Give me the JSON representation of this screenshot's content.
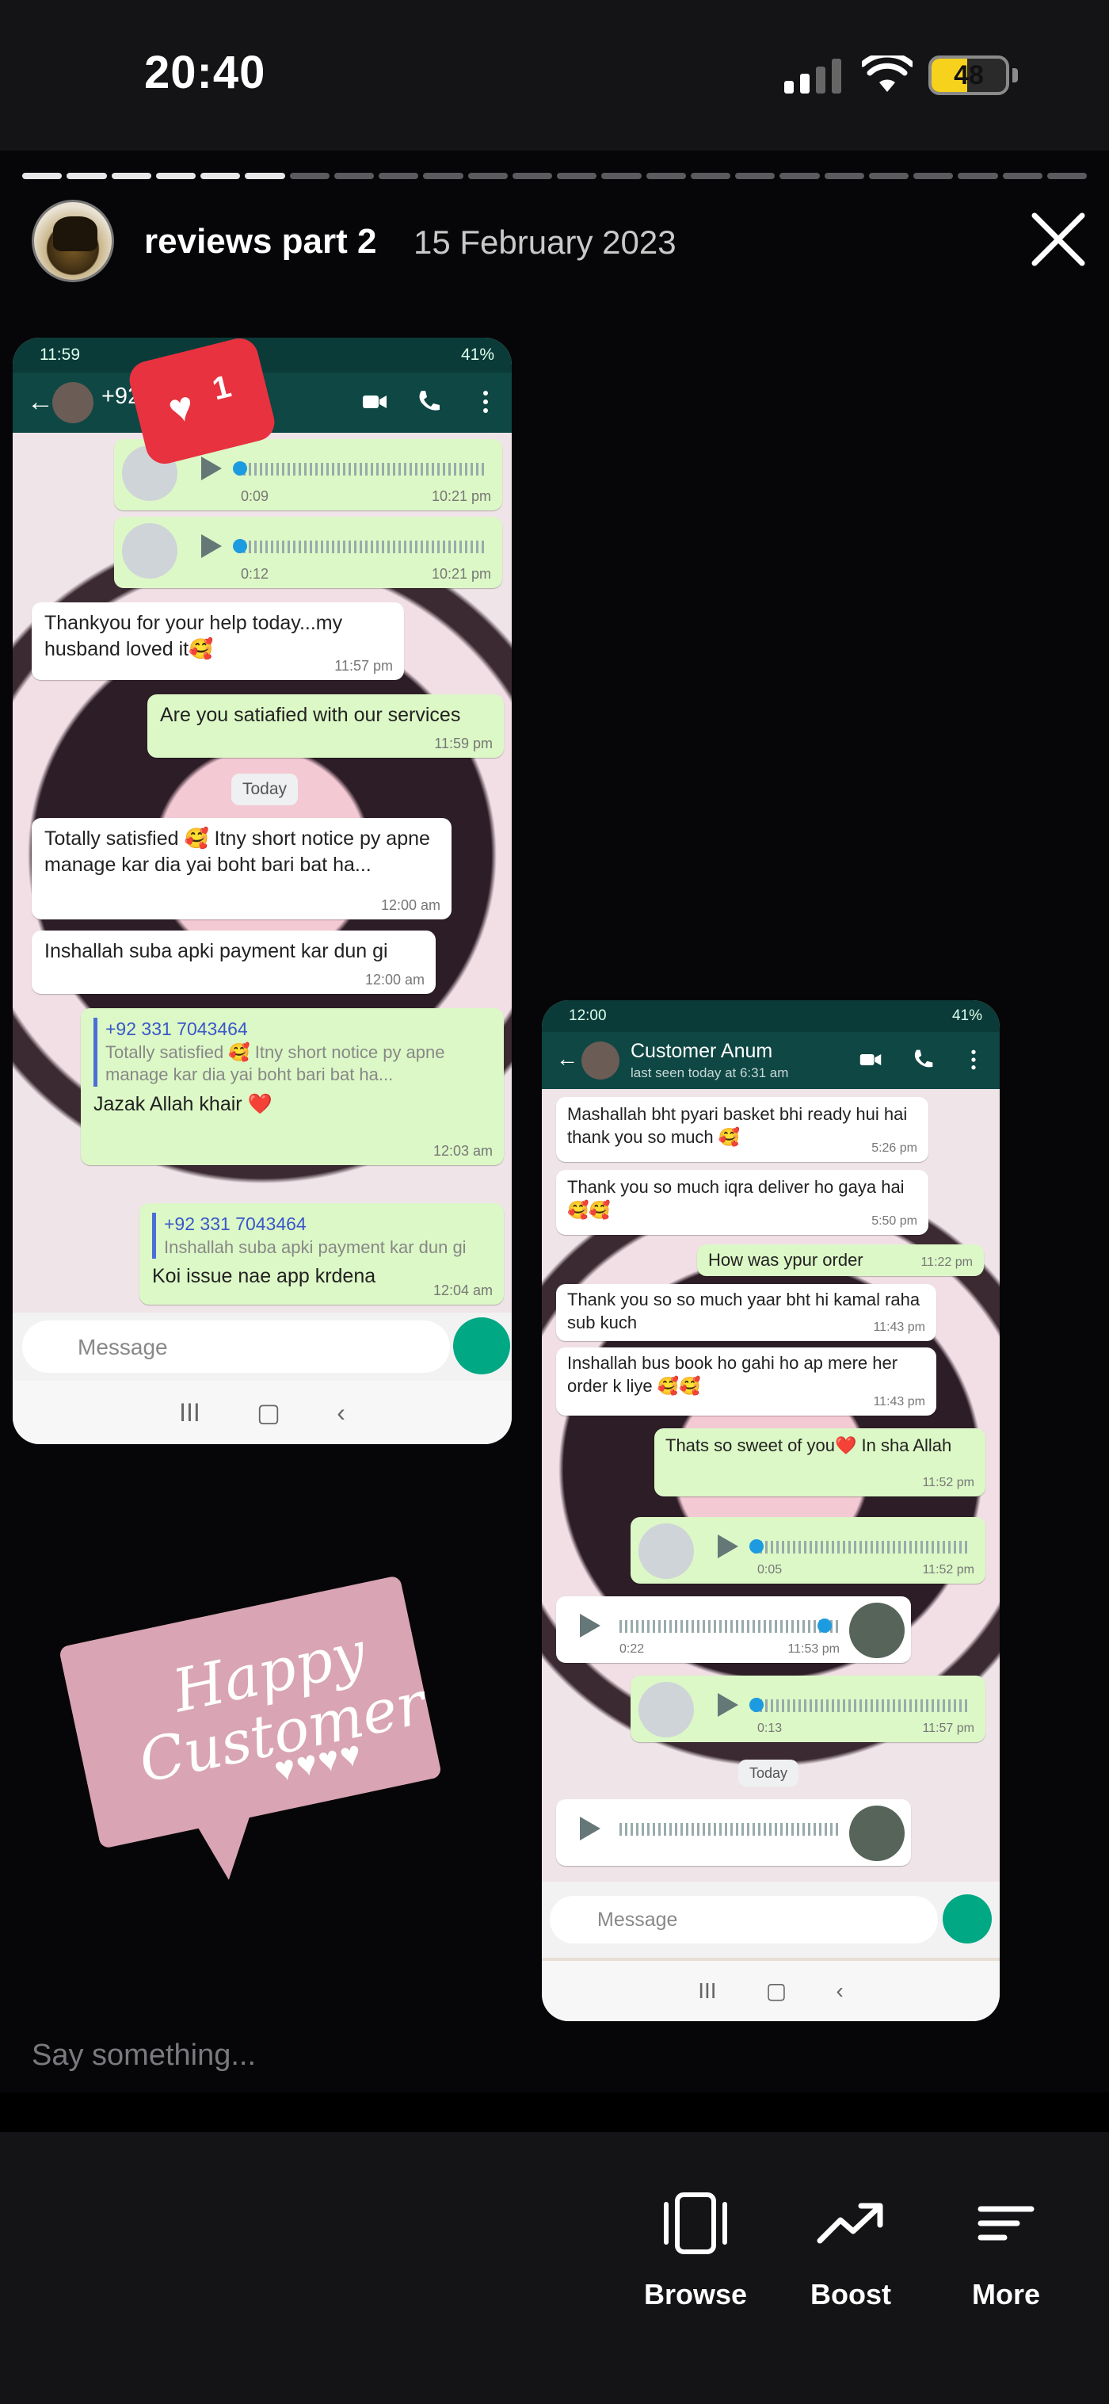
{
  "status_bar": {
    "time": "20:40",
    "battery": "48"
  },
  "story": {
    "title": "reviews part 2",
    "date": "15 February 2023",
    "progress_segments": 24,
    "progress_seen": 6,
    "reply_placeholder": "Say something..."
  },
  "screenshot_left": {
    "status_time": "11:59",
    "status_right": "41%",
    "contact": "+92",
    "reaction_count": "1",
    "messages": [
      {
        "kind": "voice",
        "dir": "out",
        "duration": "0:09",
        "time": "10:21 pm"
      },
      {
        "kind": "voice",
        "dir": "out",
        "duration": "0:12",
        "time": "10:21 pm"
      },
      {
        "kind": "text",
        "dir": "in",
        "text": "Thankyou for your help today...my husband loved it🥰",
        "time": "11:57 pm"
      },
      {
        "kind": "text",
        "dir": "out",
        "text": "Are you satiafied with our services",
        "time": "11:59 pm"
      },
      {
        "kind": "day",
        "text": "Today"
      },
      {
        "kind": "text",
        "dir": "in",
        "text": "Totally satisfied 🥰 Itny short notice py apne manage kar dia yai boht bari bat ha...",
        "time": "12:00 am"
      },
      {
        "kind": "text",
        "dir": "in",
        "text": "Inshallah suba apki payment kar dun gi",
        "time": "12:00 am"
      },
      {
        "kind": "reply",
        "dir": "out",
        "quote_from": "+92 331 7043464",
        "quote": "Totally satisfied 🥰 Itny short notice py apne manage kar dia yai boht bari bat ha...",
        "text": "Jazak Allah khair ❤️",
        "time": "12:03 am"
      },
      {
        "kind": "reply",
        "dir": "out",
        "quote_from": "+92 331 7043464",
        "quote": "Inshallah suba apki payment kar dun gi",
        "text": "Koi issue nae app krdena",
        "time": "12:04 am"
      }
    ],
    "input_placeholder": "Message"
  },
  "screenshot_right": {
    "status_time": "12:00",
    "status_right": "41%",
    "contact": "Customer Anum",
    "last_seen": "last seen today at 6:31 am",
    "messages": [
      {
        "kind": "text",
        "dir": "in",
        "text": "Mashallah bht pyari basket bhi ready hui hai thank you so much 🥰",
        "time": "5:26 pm"
      },
      {
        "kind": "text",
        "dir": "in",
        "text": "Thank you so much iqra deliver ho gaya hai 🥰🥰",
        "time": "5:50 pm"
      },
      {
        "kind": "text",
        "dir": "out",
        "text": "How was ypur order",
        "time": "11:22 pm"
      },
      {
        "kind": "text",
        "dir": "in",
        "text": "Thank you so so much yaar bht hi kamal raha sub kuch",
        "time": "11:43 pm"
      },
      {
        "kind": "text",
        "dir": "in",
        "text": "Inshallah bus book ho gahi ho ap mere her order k liye 🥰🥰",
        "time": "11:43 pm"
      },
      {
        "kind": "text",
        "dir": "out",
        "text": "Thats so sweet of you❤️ In sha Allah",
        "time": "11:52 pm"
      },
      {
        "kind": "voice",
        "dir": "out",
        "duration": "0:05",
        "time": "11:52 pm"
      },
      {
        "kind": "voice",
        "dir": "in",
        "duration": "0:22",
        "time": "11:53 pm"
      },
      {
        "kind": "voice",
        "dir": "out",
        "duration": "0:13",
        "time": "11:57 pm"
      },
      {
        "kind": "day",
        "text": "Today"
      }
    ],
    "input_placeholder": "Message"
  },
  "sticker": {
    "line1": "Happy",
    "line2": "Customer",
    "hearts": "♥♥♥♥"
  },
  "actions": [
    {
      "label": "Browse",
      "icon": "browse-icon"
    },
    {
      "label": "Boost",
      "icon": "trending-up-icon"
    },
    {
      "label": "More",
      "icon": "menu-icon"
    }
  ]
}
